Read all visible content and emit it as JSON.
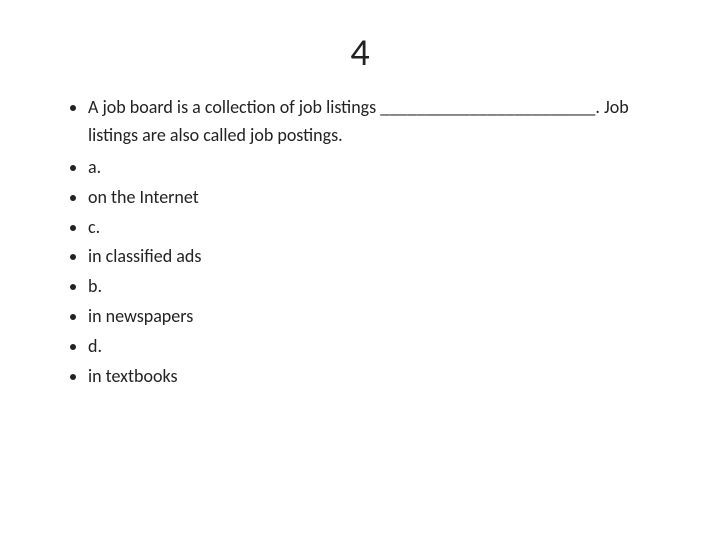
{
  "slide": {
    "number": "4",
    "items": [
      {
        "id": "intro",
        "text": "A job board is a collection of job listings ________________________. Job listings are also called job postings."
      },
      {
        "id": "a-label",
        "text": "a."
      },
      {
        "id": "on-internet",
        "text": "on the Internet"
      },
      {
        "id": "c-label",
        "text": "c."
      },
      {
        "id": "classified-ads",
        "text": "in classified ads"
      },
      {
        "id": "b-label",
        "text": "b."
      },
      {
        "id": "in-newspapers",
        "text": "in newspapers"
      },
      {
        "id": "d-label",
        "text": "d."
      },
      {
        "id": "in-textbooks",
        "text": "in textbooks"
      }
    ]
  }
}
